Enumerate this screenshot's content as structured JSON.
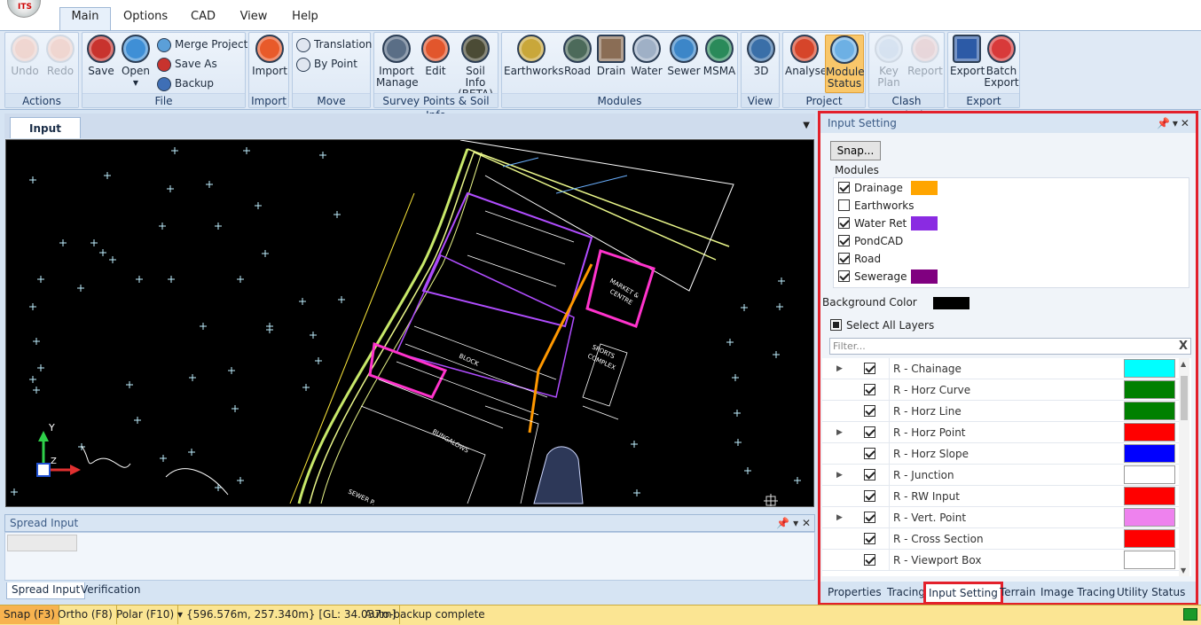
{
  "menu": {
    "tabs": [
      "Main",
      "Options",
      "CAD",
      "View",
      "Help"
    ],
    "active": "Main"
  },
  "ribbon": {
    "actions": {
      "label": "Actions",
      "undo": "Undo",
      "redo": "Redo"
    },
    "file": {
      "label": "File",
      "save": "Save",
      "open": "Open",
      "merge": "Merge Project",
      "save_as": "Save As",
      "backup": "Backup"
    },
    "import": {
      "label": "Import",
      "import": "Import"
    },
    "move": {
      "label": "Move",
      "translation": "Translation",
      "by_point": "By Point"
    },
    "survey": {
      "label": "Survey Points & Soil Info",
      "import_manage_1": "Import",
      "import_manage_2": "Manage",
      "edit": "Edit",
      "soil_1": "Soil Info",
      "soil_2": "(BETA)"
    },
    "modules": {
      "label": "Modules",
      "earthworks": "Earthworks",
      "road": "Road",
      "drain": "Drain",
      "water": "Water",
      "sewer": "Sewer",
      "msma": "MSMA"
    },
    "view": {
      "label": "View",
      "three_d": "3D"
    },
    "project": {
      "label": "Project",
      "analyse": "Analyse",
      "module_status_1": "Module",
      "module_status_2": "Status"
    },
    "clash": {
      "label": "Clash Analysis",
      "key_plan_1": "Key",
      "key_plan_2": "Plan",
      "report": "Report"
    },
    "export": {
      "label": "Export",
      "export": "Export",
      "batch_1": "Batch",
      "batch_2": "Export"
    }
  },
  "document": {
    "tab": "Input"
  },
  "spread": {
    "title": "Spread Input",
    "tabs": [
      "Spread Input",
      "Verification"
    ]
  },
  "input_setting": {
    "title": "Input Setting",
    "snap_button": "Snap...",
    "modules_label": "Modules",
    "modules": [
      {
        "name": "Drainage",
        "checked": true,
        "color": "#ffa500"
      },
      {
        "name": "Earthworks",
        "checked": false,
        "color": ""
      },
      {
        "name": "Water Ret",
        "checked": true,
        "color": "#8a2be2"
      },
      {
        "name": "PondCAD",
        "checked": true,
        "color": ""
      },
      {
        "name": "Road",
        "checked": true,
        "color": ""
      },
      {
        "name": "Sewerage",
        "checked": true,
        "color": "#800080"
      }
    ],
    "background_label": "Background Color",
    "background_color": "#000000",
    "select_all": "Select All Layers",
    "filter_placeholder": "Filter...",
    "filter_clear": "X",
    "layers": [
      {
        "name": "R - Chainage",
        "expandable": true,
        "color": "#00ffff"
      },
      {
        "name": "R - Horz Curve",
        "expandable": false,
        "color": "#008000"
      },
      {
        "name": "R - Horz Line",
        "expandable": false,
        "color": "#008000"
      },
      {
        "name": "R - Horz Point",
        "expandable": true,
        "color": "#ff0000"
      },
      {
        "name": "R - Horz Slope",
        "expandable": false,
        "color": "#0000ff"
      },
      {
        "name": "R - Junction",
        "expandable": true,
        "color": "#ffffff"
      },
      {
        "name": "R - RW Input",
        "expandable": false,
        "color": "#ff0000"
      },
      {
        "name": "R - Vert. Point",
        "expandable": true,
        "color": "#ee82ee"
      },
      {
        "name": "R - Cross Section",
        "expandable": false,
        "color": "#ff0000"
      },
      {
        "name": "R - Viewport Box",
        "expandable": false,
        "color": "#ffffff"
      }
    ],
    "tabs": [
      "Properties",
      "Tracing",
      "Input Setting",
      "Terrain",
      "Image Tracing",
      "Utility Status"
    ],
    "active_tab": "Input Setting"
  },
  "status": {
    "snap": "Snap (F3)",
    "ortho": "Ortho (F8)",
    "polar": "Polar (F10)",
    "coords": "{596.576m, 257.340m} [GL: 34.037m]",
    "message": "Auto-backup complete"
  },
  "canvas": {
    "labels": [
      "MARKET &",
      "CENTRE",
      "SPORTS",
      "COMPLEX",
      "BUNGALOWS",
      "SEWER P.",
      "BLOCK"
    ],
    "axis_y": "Y",
    "axis_z": "Z"
  }
}
